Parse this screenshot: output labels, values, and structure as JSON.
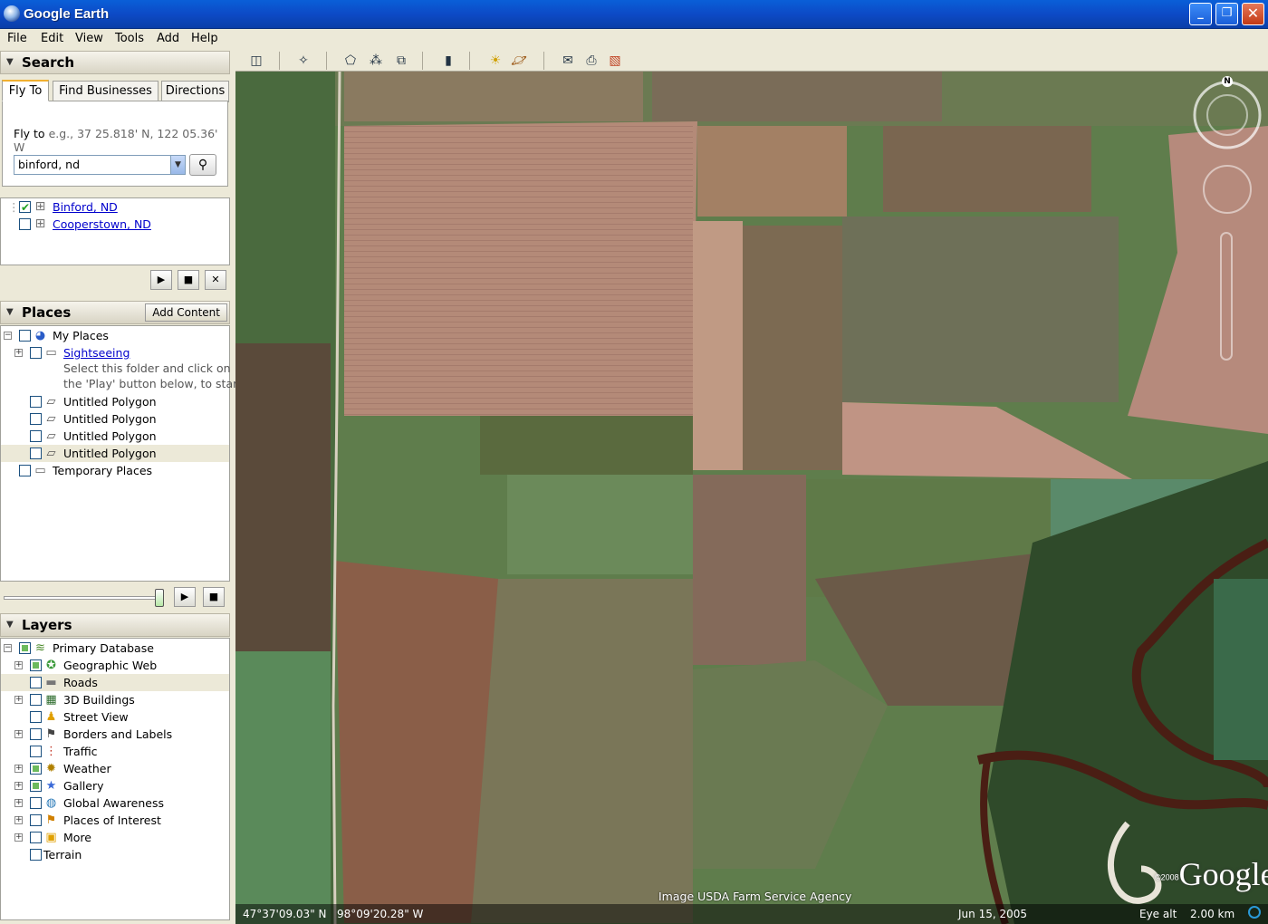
{
  "window": {
    "title": "Google Earth"
  },
  "menu": [
    "File",
    "Edit",
    "View",
    "Tools",
    "Add",
    "Help"
  ],
  "search": {
    "header": "Search",
    "tabs": [
      "Fly To",
      "Find Businesses",
      "Directions"
    ],
    "fly_label": "Fly to",
    "fly_hint": "e.g., 37 25.818' N, 122 05.36' W",
    "input_value": "binford, nd",
    "results": [
      {
        "label": "Binford, ND",
        "checked": true
      },
      {
        "label": "Cooperstown, ND",
        "checked": false
      }
    ]
  },
  "places": {
    "header": "Places",
    "add_content": "Add Content",
    "my_places": "My Places",
    "sightseeing": "Sightseeing",
    "sightseeing_hint_1": "Select this folder and click on",
    "sightseeing_hint_2": "the 'Play' button below, to start",
    "polygons": [
      "Untitled Polygon",
      "Untitled Polygon",
      "Untitled Polygon",
      "Untitled Polygon"
    ],
    "temporary": "Temporary Places"
  },
  "layers": {
    "header": "Layers",
    "primary": "Primary Database",
    "items": [
      {
        "label": "Geographic Web",
        "icon": "globe-star-icon"
      },
      {
        "label": "Roads",
        "icon": "road-icon"
      },
      {
        "label": "3D Buildings",
        "icon": "building-icon"
      },
      {
        "label": "Street View",
        "icon": "pegman-icon"
      },
      {
        "label": "Borders and Labels",
        "icon": "flag-icon"
      },
      {
        "label": "Traffic",
        "icon": "traffic-light-icon"
      },
      {
        "label": "Weather",
        "icon": "sun-icon"
      },
      {
        "label": "Gallery",
        "icon": "star-icon"
      },
      {
        "label": "Global Awareness",
        "icon": "globe-icon"
      },
      {
        "label": "Places of Interest",
        "icon": "flag-icon"
      },
      {
        "label": "More",
        "icon": "folder-icon"
      }
    ],
    "terrain": "Terrain"
  },
  "map": {
    "attribution": "Image USDA Farm Service Agency",
    "latitude": "47°37'09.03\" N",
    "longitude": "98°09'20.28\" W",
    "date": "Jun 15, 2005",
    "eye_alt_label": "Eye alt",
    "eye_alt_value": "2.00 km",
    "copyright": "©2008",
    "logo": "Google",
    "compass_n": "N"
  }
}
